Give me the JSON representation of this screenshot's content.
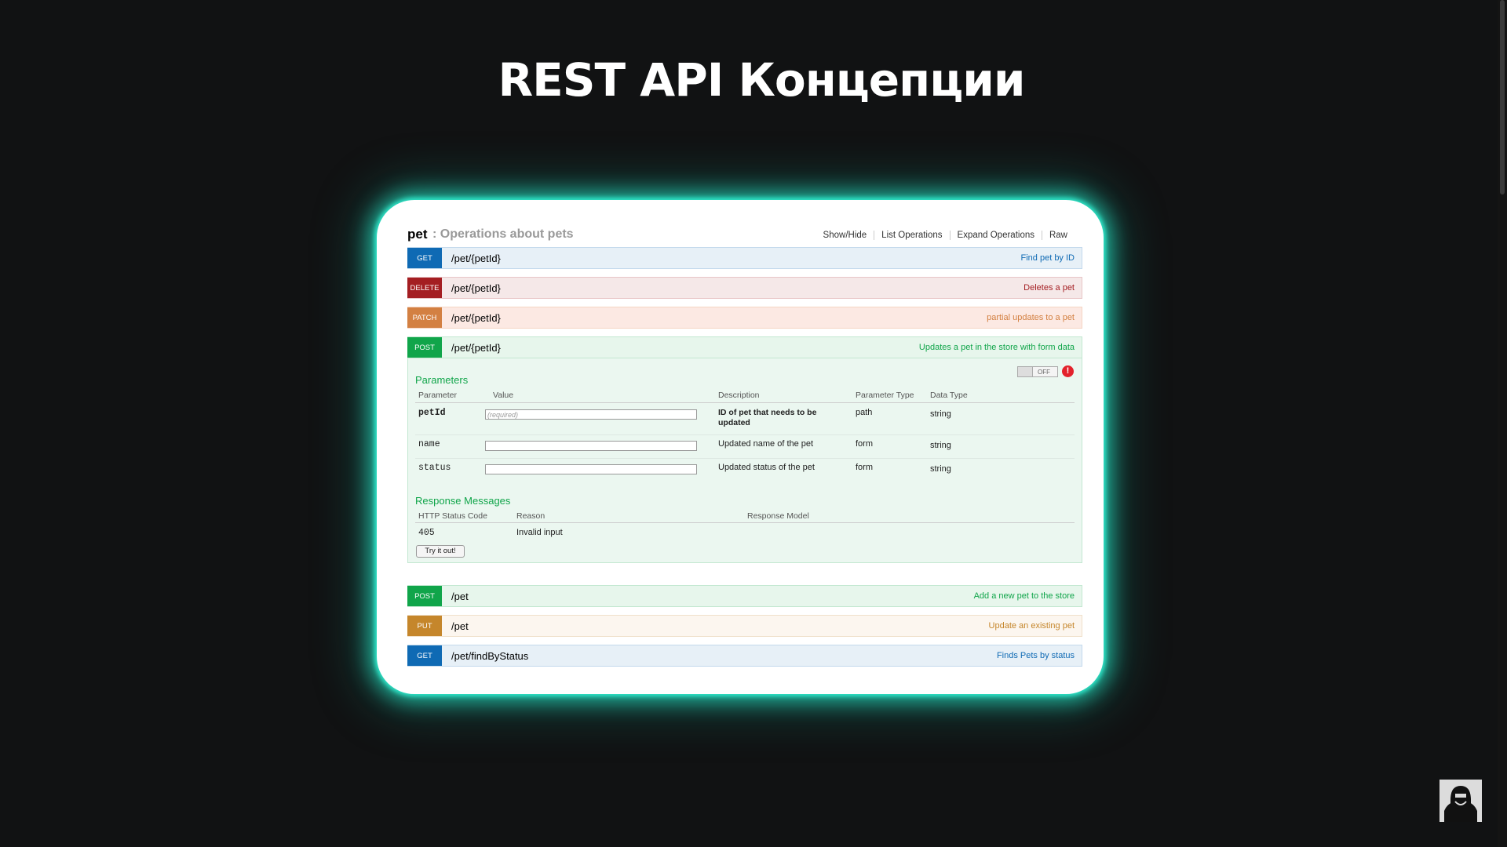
{
  "slide": {
    "title": "REST API  Концепции"
  },
  "section": {
    "name": "pet",
    "description": ": Operations about pets",
    "links": [
      "Show/Hide",
      "List Operations",
      "Expand Operations",
      "Raw"
    ]
  },
  "operations_top": [
    {
      "method": "GET",
      "path": "/pet/{petId}",
      "summary": "Find pet by ID"
    },
    {
      "method": "DELETE",
      "path": "/pet/{petId}",
      "summary": "Deletes a pet"
    },
    {
      "method": "PATCH",
      "path": "/pet/{petId}",
      "summary": "partial updates to a pet"
    },
    {
      "method": "POST",
      "path": "/pet/{petId}",
      "summary": "Updates a pet in the store with form data"
    }
  ],
  "expanded": {
    "toggle_label": "OFF",
    "warning": "!",
    "parameters_title": "Parameters",
    "param_headers": [
      "Parameter",
      "Value",
      "Description",
      "Parameter Type",
      "Data Type"
    ],
    "params": [
      {
        "name": "petId",
        "placeholder": "(required)",
        "description": "ID of pet that needs to be updated",
        "type": "path",
        "data_type": "string"
      },
      {
        "name": "name",
        "placeholder": "",
        "description": "Updated name of the pet",
        "type": "form",
        "data_type": "string"
      },
      {
        "name": "status",
        "placeholder": "",
        "description": "Updated status of the pet",
        "type": "form",
        "data_type": "string"
      }
    ],
    "responses_title": "Response Messages",
    "response_headers": [
      "HTTP Status Code",
      "Reason",
      "Response Model"
    ],
    "responses": [
      {
        "code": "405",
        "reason": "Invalid input"
      }
    ],
    "try_button": "Try it out!"
  },
  "operations_bottom": [
    {
      "method": "POST",
      "path": "/pet",
      "summary": "Add a new pet to the store"
    },
    {
      "method": "PUT",
      "path": "/pet",
      "summary": "Update an existing pet"
    },
    {
      "method": "GET",
      "path": "/pet/findByStatus",
      "summary": "Finds Pets by status"
    }
  ],
  "colors": {
    "glow": "#2fe5c8",
    "get": "#0f6ab4",
    "delete": "#a41e22",
    "patch": "#d38042",
    "post": "#10a54a",
    "put": "#c5862b"
  },
  "icons": {
    "avatar": "hacker-avatar-icon"
  }
}
